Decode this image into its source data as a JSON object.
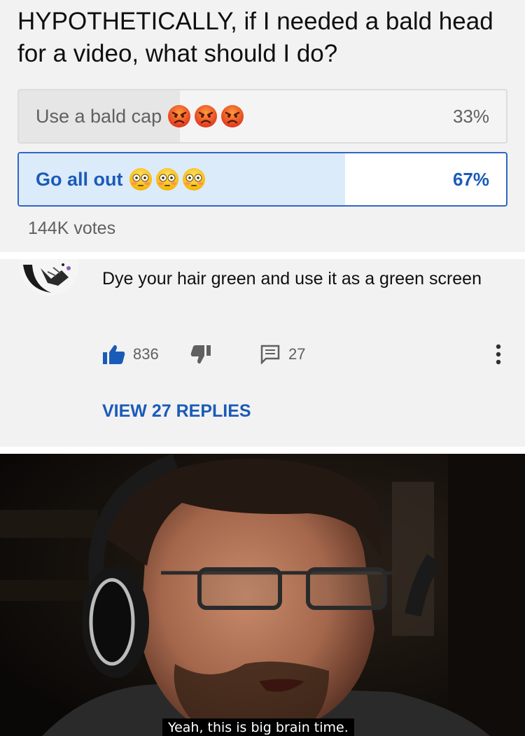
{
  "poll": {
    "question": "HYPOTHETICALLY, if I needed a bald head for a video, what should I do?",
    "options": [
      {
        "label": "Use a bald cap",
        "percent_text": "33%",
        "percent": 33,
        "emoji": "angry-face-icon",
        "emoji_count": 3
      },
      {
        "label": "Go all out",
        "percent_text": "67%",
        "percent": 67,
        "emoji": "flushed-face-icon",
        "emoji_count": 3,
        "selected": true
      }
    ],
    "votes": "144K votes"
  },
  "comment": {
    "text": "Dye your hair green and use it as a green screen",
    "likes": "836",
    "replies_count": "27",
    "view_replies": "VIEW 27 REPLIES"
  },
  "meme": {
    "caption": "Yeah, this is big brain time."
  },
  "colors": {
    "accent": "#1a5bb8",
    "poll_bg": "#f2f2f2",
    "selected_fill": "#dcebfa",
    "unselected_fill": "#e6e6e6"
  }
}
